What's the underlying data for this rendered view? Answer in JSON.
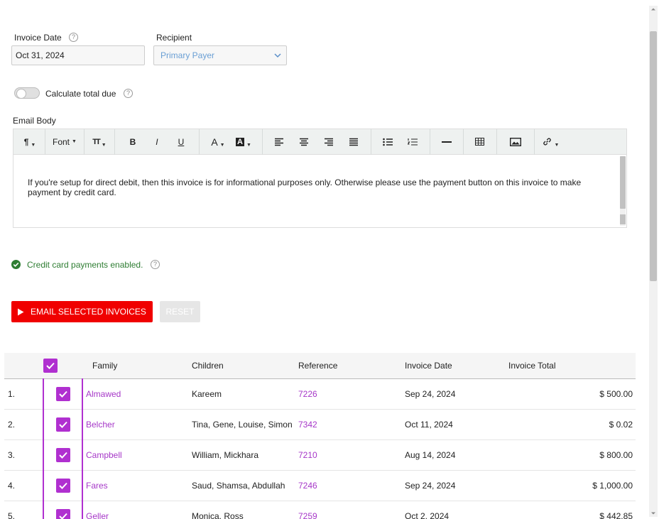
{
  "form": {
    "invoice_date_label": "Invoice Date",
    "invoice_date_value": "Oct 31, 2024",
    "recipient_label": "Recipient",
    "recipient_value": "Primary Payer",
    "calc_total_label": "Calculate total due",
    "calc_total_on": false,
    "email_body_label": "Email Body",
    "help_glyph": "?"
  },
  "editor": {
    "toolbar": {
      "paragraph": "¶",
      "font": "Font",
      "text_size": "TT",
      "bold": "B",
      "italic": "I",
      "underline": "U",
      "font_color": "A",
      "highlight": "A"
    },
    "body_text": "If you're setup for direct debit, then this invoice is for informational purposes only.  Otherwise please use the payment button on this invoice to make payment by credit card."
  },
  "status": {
    "credit_card_msg": "Credit card payments enabled."
  },
  "actions": {
    "email_button": "EMAIL SELECTED INVOICES",
    "reset_button": "RESET"
  },
  "table": {
    "headers": {
      "family": "Family",
      "children": "Children",
      "reference": "Reference",
      "invoice_date": "Invoice Date",
      "invoice_total": "Invoice Total"
    },
    "rows": [
      {
        "num": "1.",
        "family": "Almawed",
        "children": "Kareem",
        "reference": "7226",
        "date": "Sep 24, 2024",
        "total": "$ 500.00"
      },
      {
        "num": "2.",
        "family": "Belcher",
        "children": "Tina, Gene, Louise, Simon",
        "reference": "7342",
        "date": "Oct 11, 2024",
        "total": "$ 0.02"
      },
      {
        "num": "3.",
        "family": "Campbell",
        "children": "William, Mickhara",
        "reference": "7210",
        "date": "Aug 14, 2024",
        "total": "$ 800.00"
      },
      {
        "num": "4.",
        "family": "Fares",
        "children": "Saud, Shamsa, Abdullah",
        "reference": "7246",
        "date": "Sep 24, 2024",
        "total": "$ 1,000.00"
      },
      {
        "num": "5.",
        "family": "Geller",
        "children": "Monica, Ross",
        "reference": "7259",
        "date": "Oct 2, 2024",
        "total": "$ 442.85"
      }
    ]
  },
  "colors": {
    "accent_purple": "#b030d0",
    "primary_red": "#f00000",
    "success_green": "#2e7d32",
    "link_blue": "#6a9fd4"
  }
}
